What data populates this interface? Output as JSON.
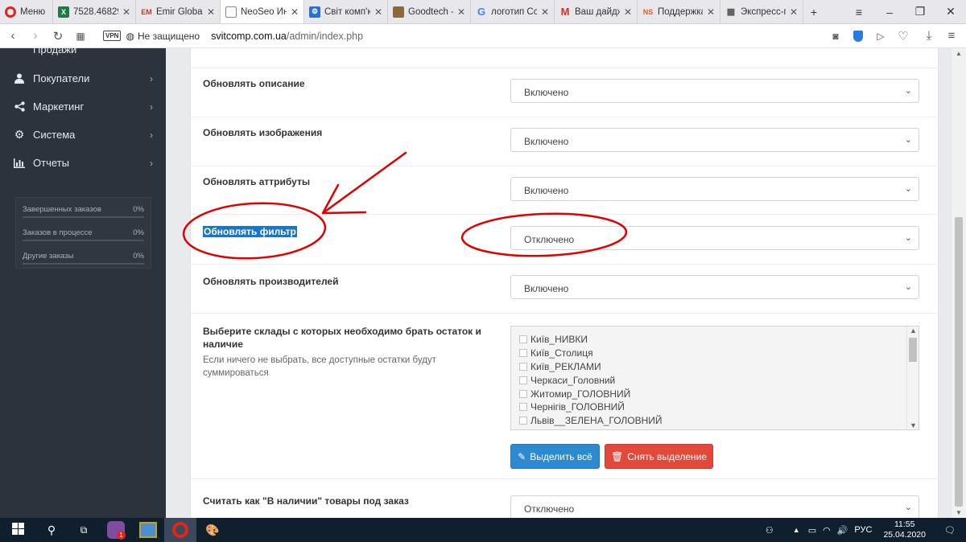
{
  "browser": {
    "tabs": [
      {
        "title": "Меню",
        "fav": "opera-icon",
        "color": "#e0261b"
      },
      {
        "title": "7528.46829",
        "fav": "excel-icon",
        "color": "#1d7a45"
      },
      {
        "title": "Emir Global",
        "fav": "em-icon",
        "color": "#c0392b"
      },
      {
        "title": "NeoSeo Инт",
        "fav": "page-icon",
        "color": "#555555"
      },
      {
        "title": "Світ комп'ю",
        "fav": "settings-icon",
        "color": "#2a6fd6"
      },
      {
        "title": "Goodtech -",
        "fav": "goodtech-icon",
        "color": "#8a6a3a"
      },
      {
        "title": "логотип Сс",
        "fav": "google-icon",
        "color": "#4285f4"
      },
      {
        "title": "Ваш дайдж",
        "fav": "gmail-icon",
        "color": "#d93025"
      },
      {
        "title": "Поддержка",
        "fav": "ns-icon",
        "color": "#e05a2a"
      },
      {
        "title": "Экспресс-п",
        "fav": "grid-icon",
        "color": "#555555"
      }
    ],
    "vpn_label": "VPN",
    "security_label": "Не защищено",
    "url_domain": "svitcomp.com.ua",
    "url_path": "/admin/index.php"
  },
  "sidebar": {
    "top_partial": "Продажи",
    "items": [
      {
        "label": "Покупатели",
        "icon": "user-icon"
      },
      {
        "label": "Маркетинг",
        "icon": "share-icon"
      },
      {
        "label": "Система",
        "icon": "gear-icon"
      },
      {
        "label": "Отчеты",
        "icon": "bar-chart-icon"
      }
    ],
    "stats": [
      {
        "label": "Завершенных заказов",
        "value": "0%"
      },
      {
        "label": "Заказов в процессе",
        "value": "0%"
      },
      {
        "label": "Другие заказы",
        "value": "0%"
      }
    ]
  },
  "form": {
    "rows": [
      {
        "label": "Обновлять описание",
        "value": "Включено"
      },
      {
        "label": "Обновлять изображения",
        "value": "Включено"
      },
      {
        "label": "Обновлять аттрибуты",
        "value": "Включено"
      },
      {
        "label": "Обновлять фильтр",
        "value": "Отключено"
      },
      {
        "label": "Обновлять производителей",
        "value": "Включено"
      }
    ],
    "warehouses": {
      "label": "Выберите склады с которых необходимо брать остаток и наличие",
      "help": "Если ничего не выбрать, все доступные остатки будут суммироваться",
      "options": [
        "Київ_НИВКИ",
        "Київ_Столиця",
        "Київ_РЕКЛАМИ",
        "Черкаси_Головний",
        "Житомир_ГОЛОВНИЙ",
        "Чернігів_ГОЛОВНИЙ",
        "Львів__ЗЕЛЕНА_ГОЛОВНИЙ"
      ],
      "select_all": "Выделить всё",
      "deselect": "Снять выделение"
    },
    "last_row": {
      "label": "Считать как \"В наличии\" товары под заказ",
      "value": "Отключено"
    }
  },
  "taskbar": {
    "lang": "РУС",
    "time": "11:55",
    "date": "25.04.2020",
    "badge": "1"
  }
}
